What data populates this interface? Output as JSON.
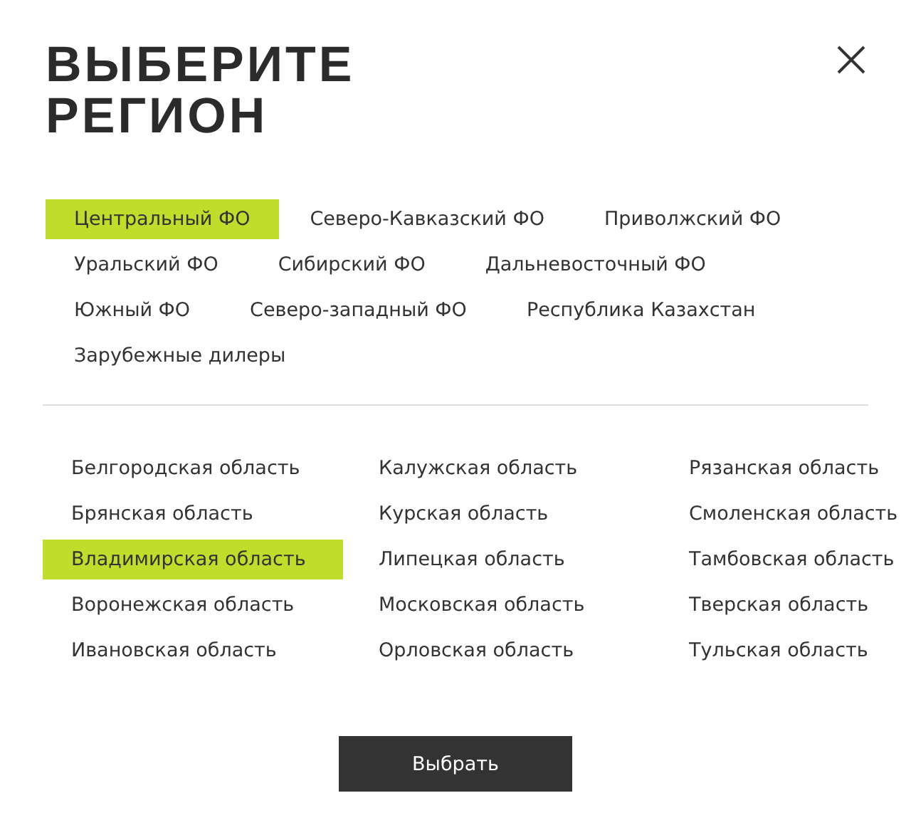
{
  "dialog": {
    "title": "ВЫБЕРИТЕ РЕГИОН"
  },
  "districts": [
    {
      "label": "Центральный ФО",
      "selected": true
    },
    {
      "label": "Северо-Кавказский ФО",
      "selected": false
    },
    {
      "label": "Приволжский ФО",
      "selected": false
    },
    {
      "label": "Уральский ФО",
      "selected": false
    },
    {
      "label": "Сибирский ФО",
      "selected": false
    },
    {
      "label": "Дальневосточный ФО",
      "selected": false
    },
    {
      "label": "Южный ФО",
      "selected": false
    },
    {
      "label": "Северо-западный ФО",
      "selected": false
    },
    {
      "label": "Республика Казахстан",
      "selected": false
    },
    {
      "label": "Зарубежные дилеры",
      "selected": false
    }
  ],
  "regions": [
    {
      "label": "Белгородская область",
      "selected": false
    },
    {
      "label": "Брянская область",
      "selected": false
    },
    {
      "label": "Владимирская область",
      "selected": true
    },
    {
      "label": "Воронежская область",
      "selected": false
    },
    {
      "label": "Ивановская область",
      "selected": false
    },
    {
      "label": "Калужская область",
      "selected": false
    },
    {
      "label": "Курская область",
      "selected": false
    },
    {
      "label": "Липецкая область",
      "selected": false
    },
    {
      "label": "Московская область",
      "selected": false
    },
    {
      "label": "Орловская область",
      "selected": false
    },
    {
      "label": "Рязанская область",
      "selected": false
    },
    {
      "label": "Смоленская область",
      "selected": false
    },
    {
      "label": "Тамбовская область",
      "selected": false
    },
    {
      "label": "Тверская область",
      "selected": false
    },
    {
      "label": "Тульская область",
      "selected": false
    }
  ],
  "submit_button": {
    "label": "Выбрать"
  }
}
